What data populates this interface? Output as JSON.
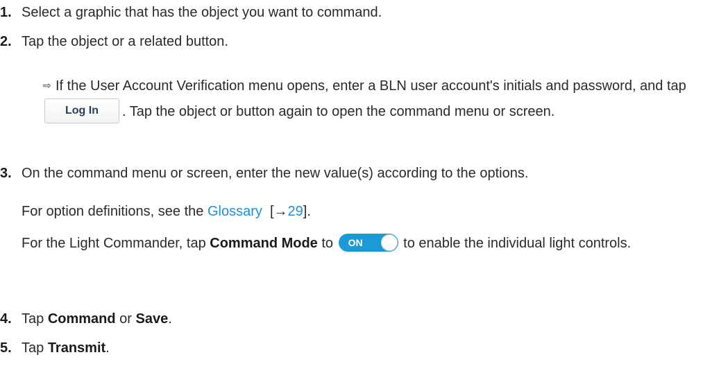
{
  "steps": [
    {
      "num": "1.",
      "text": "Select a graphic that has the object you want to command."
    },
    {
      "num": "2.",
      "text": "Tap the object or a related button."
    },
    {
      "num": "3.",
      "text": "On the command menu or screen, enter the new value(s) according to the options."
    },
    {
      "num": "4.",
      "text_pre": "Tap ",
      "bold1": "Command",
      "mid": " or ",
      "bold2": "Save",
      "post": "."
    },
    {
      "num": "5.",
      "text_pre": "Tap ",
      "bold1": "Transmit",
      "post": "."
    }
  ],
  "note": {
    "arrow": "⇨",
    "text1": "If the User Account Verification menu opens, enter a BLN user account's initials and password, and tap",
    "button": "Log In",
    "text2": ". Tap the object or button again to open the command menu or screen."
  },
  "glossary_para": {
    "pre": "For option definitions, see the ",
    "link": "Glossary",
    "ref_open": "  [→",
    "ref_link": "29",
    "ref_close": "]."
  },
  "light_para": {
    "pre": "For the Light Commander, tap ",
    "bold": "Command Mode",
    "mid": " to ",
    "toggle_label": "ON",
    "post": " to enable the individual light controls."
  },
  "colors": {
    "link": "#1f8fd6",
    "toggle": "#1c9ad6"
  }
}
